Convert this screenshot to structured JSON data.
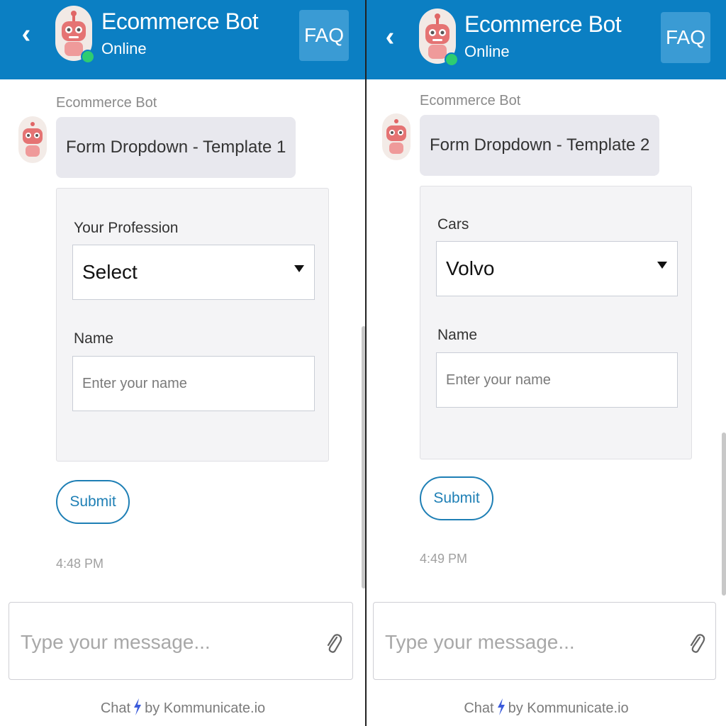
{
  "panels": [
    {
      "header": {
        "back_icon": "chevron-left-icon",
        "bot_name": "Ecommerce Bot",
        "status": "Online",
        "faq_label": "FAQ"
      },
      "message": {
        "sender": "Ecommerce Bot",
        "text": "Form Dropdown - Template 1"
      },
      "form": {
        "dropdown_label": "Your Profession",
        "dropdown_value": "Select",
        "name_label": "Name",
        "name_placeholder": "Enter your name"
      },
      "submit_label": "Submit",
      "timestamp": "4:48 PM",
      "compose_placeholder": "Type your message...",
      "footer": {
        "prefix": "Chat",
        "suffix": "by Kommunicate.io"
      }
    },
    {
      "header": {
        "back_icon": "chevron-left-icon",
        "bot_name": "Ecommerce Bot",
        "status": "Online",
        "faq_label": "FAQ"
      },
      "message": {
        "sender": "Ecommerce Bot",
        "text": "Form Dropdown - Template 2"
      },
      "form": {
        "dropdown_label": "Cars",
        "dropdown_value": "Volvo",
        "name_label": "Name",
        "name_placeholder": "Enter your name"
      },
      "submit_label": "Submit",
      "timestamp": "4:49 PM",
      "compose_placeholder": "Type your message...",
      "footer": {
        "prefix": "Chat",
        "suffix": "by Kommunicate.io"
      }
    }
  ],
  "colors": {
    "header_bg": "#0b7fc3",
    "faq_bg": "#3a9bd4",
    "online_dot": "#2ecc71",
    "submit_border": "#1e7fb5",
    "bubble_bg": "#e8e8ee",
    "bolt": "#3b5bdb"
  }
}
